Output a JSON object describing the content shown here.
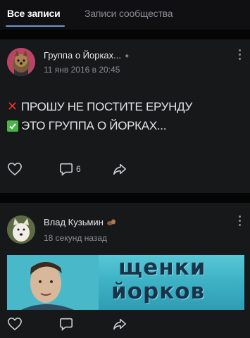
{
  "tabs": {
    "all_posts": "Все записи",
    "community_posts": "Записи сообщества"
  },
  "post1": {
    "author": "Группа о Йорках...",
    "time": "11 янв 2016 в 20:45",
    "line1": "ПРОШУ НЕ ПОСТИТЕ ЕРУНДУ",
    "line2": "ЭТО ГРУППА О ЙОРКАХ...",
    "comments_count": "6"
  },
  "post2": {
    "author": "Влад Кузьмин",
    "time": "18 секунд назад",
    "banner_line1": "щенки",
    "banner_line2": "йорков"
  },
  "icons": [
    "like-icon",
    "comment-icon",
    "share-icon",
    "more-icon",
    "pin-icon",
    "cross-emoji-icon",
    "check-emoji-icon",
    "squirrel-emoji-icon"
  ],
  "colors": {
    "background": "#0d0d0f",
    "card": "#17181a",
    "accent_tab": "#6f96c8",
    "red_cross": "#e5342d",
    "green_check": "#4bb34b"
  }
}
